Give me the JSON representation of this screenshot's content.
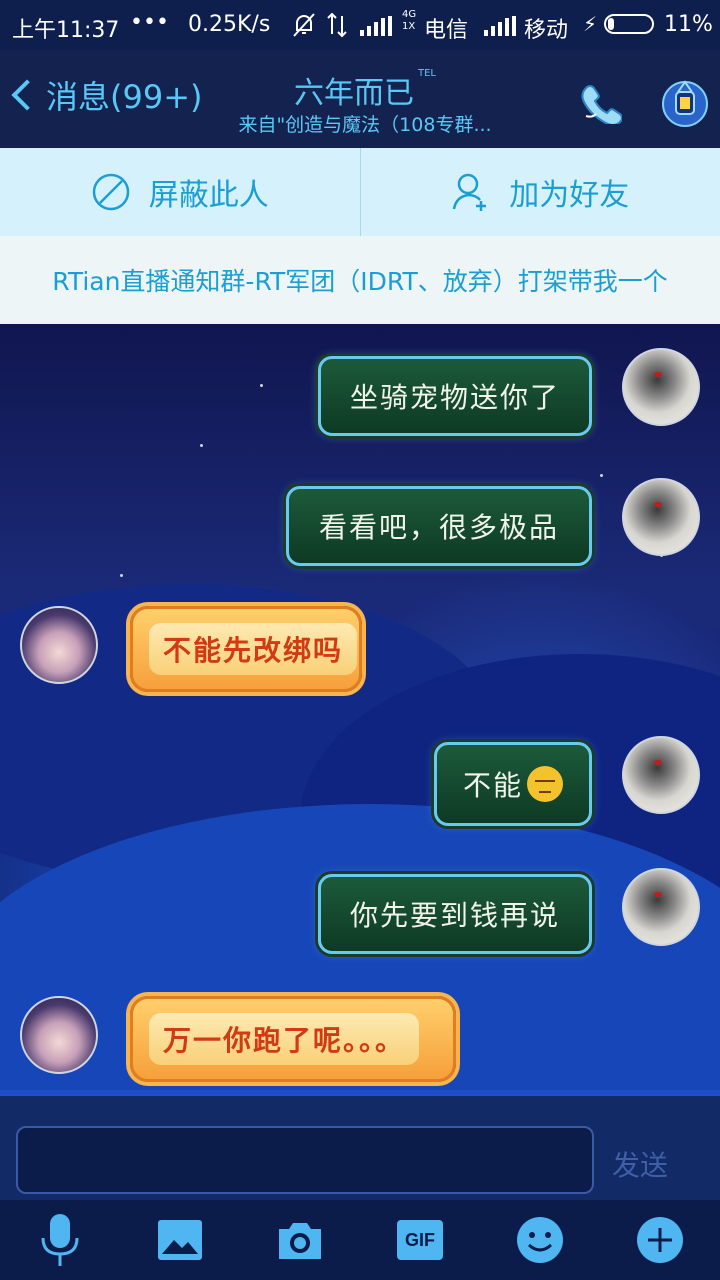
{
  "status_bar": {
    "time": "上午11:37",
    "dots": "•••",
    "speed": "0.25K/s",
    "network_4g": "4G",
    "network_1x": "1X",
    "carrier1": "电信",
    "carrier2": "移动",
    "battery": "11%"
  },
  "header": {
    "back_label": "消息(99+)",
    "title": "六年而已",
    "title_badge": "TEL",
    "subtitle": "来自\"创造与魔法（108专群..."
  },
  "actions": {
    "block_label": "屏蔽此人",
    "add_friend_label": "加为好友"
  },
  "notice": "RTian直播通知群-RT军团（IDRT、放弃）打架带我一个",
  "messages": [
    {
      "from": "me",
      "text": "坐骑宠物送你了"
    },
    {
      "from": "me",
      "text": "看看吧，很多极品"
    },
    {
      "from": "other",
      "text": "不能先改绑吗"
    },
    {
      "from": "me",
      "text": "不能"
    },
    {
      "from": "me",
      "text": "你先要到钱再说"
    },
    {
      "from": "other",
      "text": "万一你跑了呢。。。"
    }
  ],
  "input": {
    "send_label": "发送"
  },
  "toolbar": {
    "gif_label": "GIF"
  },
  "colors": {
    "accent": "#58c8f7",
    "action_bg": "#d5f1fb",
    "bubble_me": "#1c5a3a",
    "bubble_other": "#f6a03b"
  }
}
